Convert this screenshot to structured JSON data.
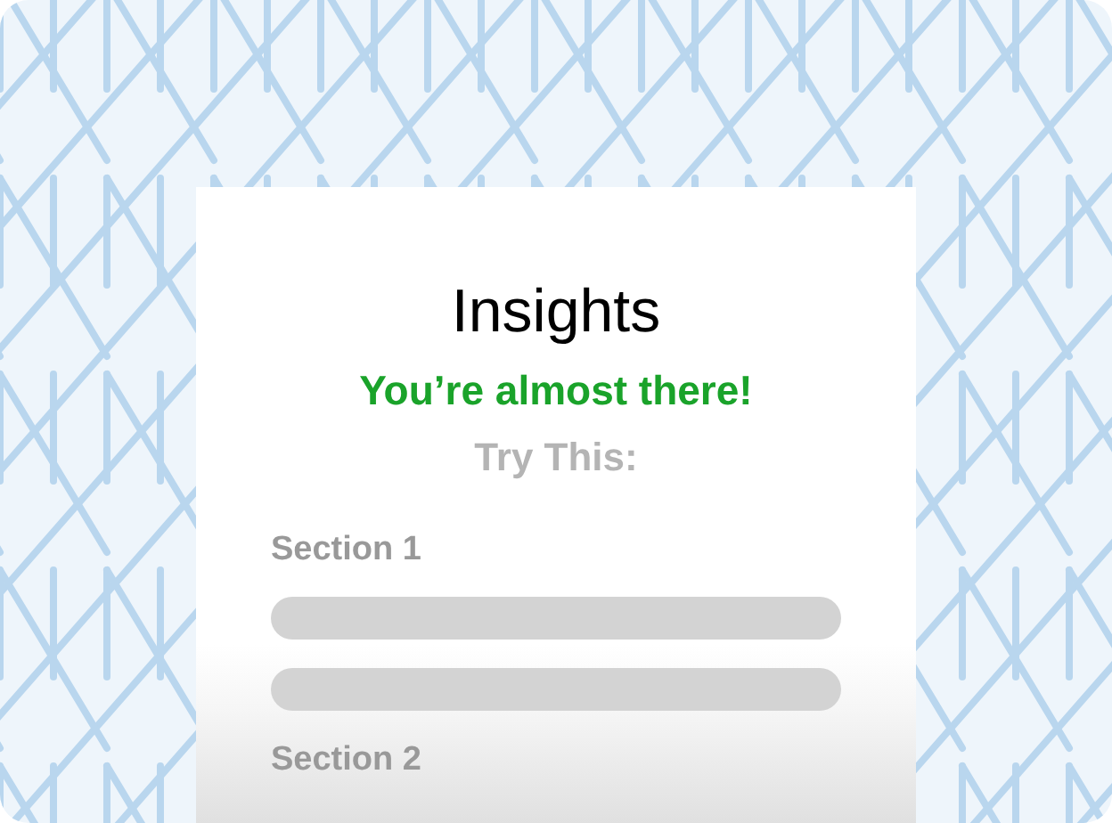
{
  "card": {
    "title": "Insights",
    "subtitle": "You’re almost there!",
    "prompt": "Try This:",
    "sections": [
      {
        "label": "Section 1",
        "placeholders": [
          {
            "kind": "skeleton-line"
          },
          {
            "kind": "skeleton-line"
          }
        ]
      },
      {
        "label": "Section 2"
      }
    ]
  }
}
